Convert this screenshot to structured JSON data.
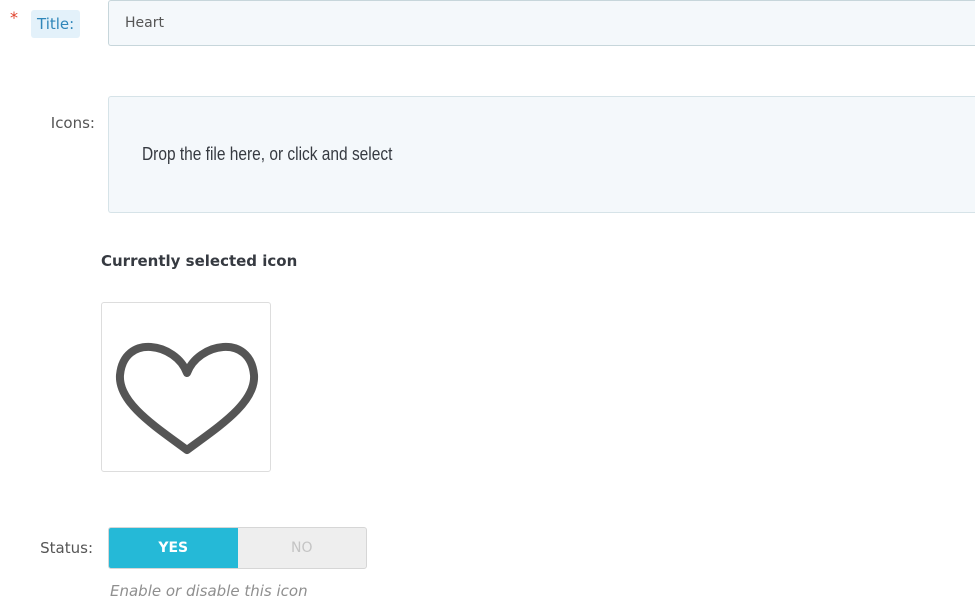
{
  "title_field": {
    "required_marker": "*",
    "label": "Title:",
    "value": "Heart"
  },
  "icons_field": {
    "label": "Icons:",
    "dropzone_text": "Drop the file here, or click and select"
  },
  "current_icon": {
    "heading": "Currently selected icon",
    "icon": "heart-outline-icon"
  },
  "status_field": {
    "label": "Status:",
    "yes_label": "YES",
    "no_label": "NO",
    "selected": "YES",
    "help": "Enable or disable this icon"
  },
  "colors": {
    "accent": "#25b9d7",
    "required": "#e0402a",
    "label_link": "#2f86b9",
    "input_bg": "#f4f8fb"
  }
}
